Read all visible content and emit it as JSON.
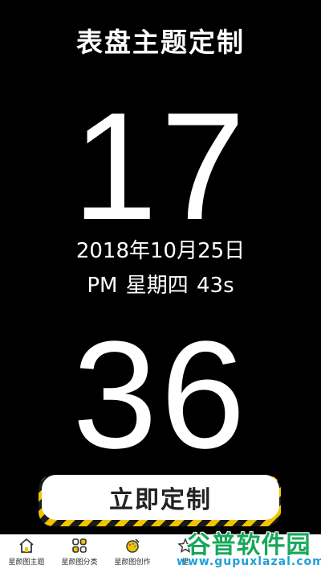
{
  "header": {
    "title": "表盘主题定制"
  },
  "clock": {
    "hour": "17",
    "date": "2018年10月25日",
    "ampm_weekday_seconds": "PM 星期四 43s",
    "minute": "36"
  },
  "cta": {
    "label": "立即定制"
  },
  "colors": {
    "background": "#000000",
    "text": "#ffffff",
    "stripe_yellow": "#f2c400",
    "tab_bg": "#ffffff"
  },
  "tabbar": {
    "items": [
      {
        "label": "星颜图主题",
        "icon": "home-icon"
      },
      {
        "label": "星颜图分类",
        "icon": "grid-icon"
      },
      {
        "label": "星颜图创作",
        "icon": "palette-icon"
      },
      {
        "label": "星",
        "icon": "star-icon"
      }
    ]
  },
  "watermark": {
    "brand": "谷普软件园",
    "url": "www.gupuxlazal.com"
  }
}
